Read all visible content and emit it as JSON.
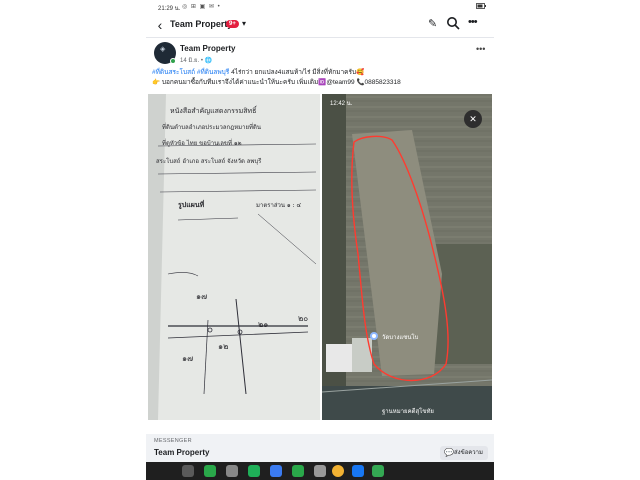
{
  "status_bar": {
    "time": "21:29 น.",
    "icons": "◎ ⊞ ▣ ✉ •",
    "battery": "▮"
  },
  "header": {
    "title": "Team Property",
    "badge": "9+",
    "dropdown_icon": "chevron-down-icon",
    "actions": [
      "edit-icon",
      "search-icon",
      "more-icon"
    ]
  },
  "post": {
    "author": "Team Property",
    "meta": "14 มิ.ย. • 🌐",
    "caption": {
      "hashtags": "#ที่ดินสระโบสถ์ #ที่ดินลพบุรี",
      "text1": " 4ไร่กว่า ยกแปลง4แสนห้า/ไร่ มีสิ่งที่ทักมาครับ🥰",
      "text2": "👉 บอกคนมาซื้อกับทีมเราจึงได้ค่าแนะนำให้นะครับ เพิ่มเติม🆔@team99 📞0885823318"
    },
    "document_image": {
      "lines": [
        "หนังสือสำคัญแสดงกรรมสิทธิ์",
        "ที่ดินตำบลอำเภอประมวลกฎหมายที่ดิน",
        "ที่ดูหัวข้อ   ไทย    ขอบ้านเลขที่  ๑๒",
        "สระโบสถ์     อำเภอ  สระโบสถ์     จังหวัด  ลพบุรี",
        "รูปแผนที่",
        "มาตราส่วน  ๑ : ๔"
      ],
      "marks": [
        "๑๗",
        "๒๑",
        "๑๒",
        "๑๗",
        "๒๐"
      ]
    },
    "satellite_image": {
      "time": "12:42 น.",
      "place_label": "วัดบางแซนโบ",
      "bottom_label": "ฐานหมายคดีสุโขทัย"
    }
  },
  "messenger": {
    "label": "MESSENGER",
    "name": "Team Property",
    "button": "ส่งข้อความ"
  },
  "colors": {
    "accent": "#1877f2",
    "badge": "#e41e3f",
    "outline": "#ff3b30"
  }
}
